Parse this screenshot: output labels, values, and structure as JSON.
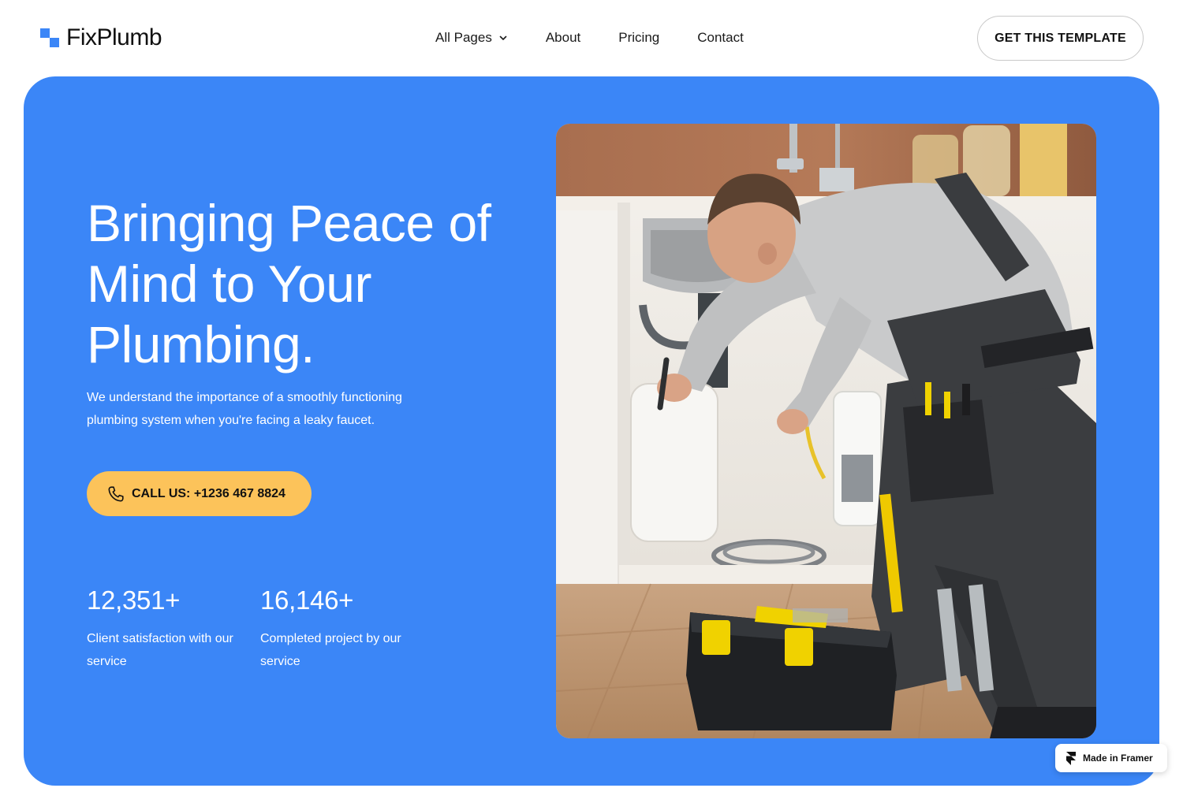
{
  "brand": {
    "name": "FixPlumb",
    "accent_color": "#3b86f7"
  },
  "nav": {
    "items": [
      {
        "label": "All Pages",
        "has_dropdown": true
      },
      {
        "label": "About"
      },
      {
        "label": "Pricing"
      },
      {
        "label": "Contact"
      }
    ],
    "cta_label": "GET THIS TEMPLATE"
  },
  "hero": {
    "title": "Bringing Peace of Mind to Your Plumbing.",
    "subtitle": "We understand the importance of a smoothly functioning plumbing system when you're facing a leaky faucet.",
    "call_button_label": "CALL US: +1236 467 8824",
    "call_button_color": "#fcc35a",
    "background_color": "#3b86f7",
    "stats": [
      {
        "value": "12,351+",
        "label": "Client satisfaction with our service"
      },
      {
        "value": "16,146+",
        "label": "Completed project by our service"
      }
    ],
    "image_icon": "plumber-photo"
  },
  "badge": {
    "label": "Made in Framer",
    "icon": "framer-icon"
  }
}
